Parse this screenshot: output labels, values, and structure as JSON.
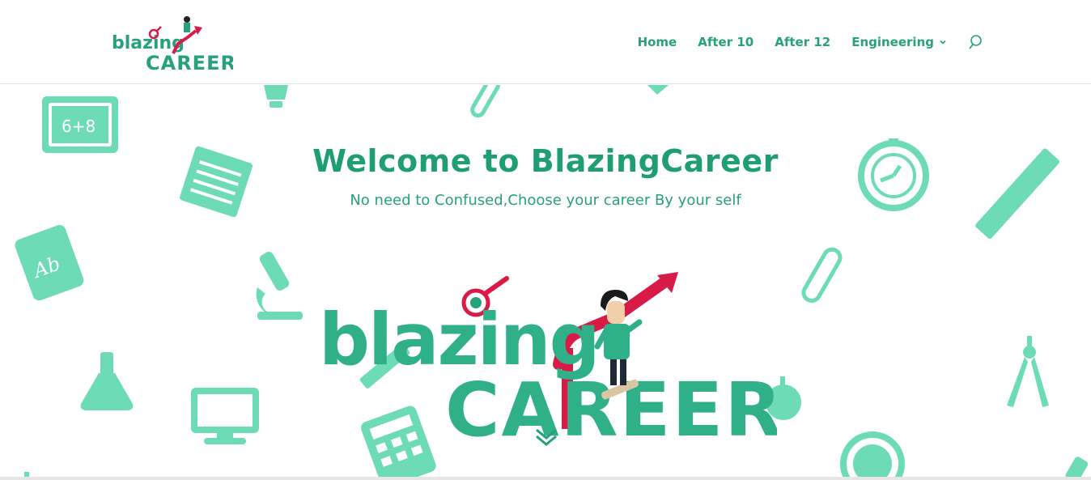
{
  "header": {
    "logo": {
      "line1": "blazing",
      "line2": "CAREER"
    },
    "nav": [
      {
        "label": "Home"
      },
      {
        "label": "After 10"
      },
      {
        "label": "After 12"
      },
      {
        "label": "Engineering",
        "has_dropdown": true
      }
    ],
    "search_icon": "search-icon"
  },
  "hero": {
    "title": "Welcome to BlazingCareer",
    "subtitle": "No need to Confused,Choose your career By your self",
    "logo": {
      "line1": "blazing",
      "line2": "CAREER"
    },
    "scroll_icon": "chevron-down-icon"
  },
  "colors": {
    "brand_green": "#27a17c",
    "brand_red": "#d81b46",
    "doodle_green": "#5fd9b0"
  }
}
